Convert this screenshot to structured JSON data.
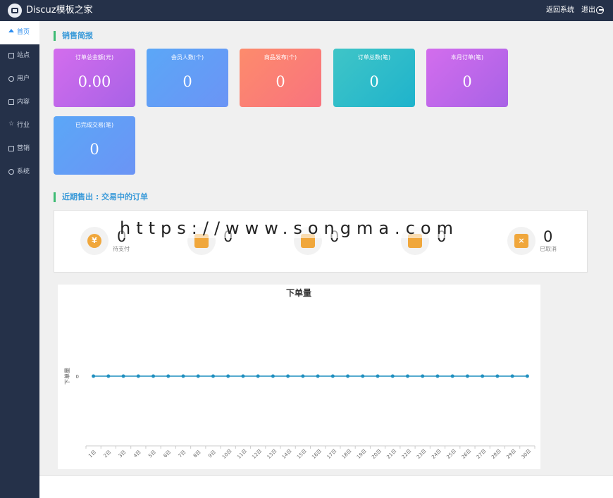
{
  "header": {
    "app_title": "Discuz模板之家",
    "return_link": "返回系统",
    "logout_link": "退出"
  },
  "sidebar": {
    "items": [
      {
        "label": "首页",
        "active": true
      },
      {
        "label": "站点"
      },
      {
        "label": "用户"
      },
      {
        "label": "内容"
      },
      {
        "label": "行业"
      },
      {
        "label": "营销"
      },
      {
        "label": "系统"
      }
    ]
  },
  "sales": {
    "title": "销售简报",
    "cards": [
      {
        "label": "订单总金额(元)",
        "value": "0.00",
        "gradient": [
          "#d36ded",
          "#a862e6"
        ]
      },
      {
        "label": "会员人数(个)",
        "value": "0",
        "gradient": [
          "#5ba7f7",
          "#6b94f5"
        ]
      },
      {
        "label": "商品发布(个)",
        "value": "0",
        "gradient": [
          "#fd8b6c",
          "#f8737e"
        ]
      },
      {
        "label": "订单总数(笔)",
        "value": "0",
        "gradient": [
          "#3fc5c7",
          "#1fb3cc"
        ]
      },
      {
        "label": "本月订单(笔)",
        "value": "0",
        "gradient": [
          "#d36ded",
          "#a862e6"
        ]
      },
      {
        "label": "已完成交易(笔)",
        "value": "0",
        "gradient": [
          "#5ba7f7",
          "#6b94f5"
        ]
      }
    ]
  },
  "orders": {
    "title": "近期售出 : 交易中的订单",
    "items": [
      {
        "count": "0",
        "label": "待支付",
        "icon": "yen-icon"
      },
      {
        "count": "0",
        "label": "",
        "icon": "package-icon"
      },
      {
        "count": "0",
        "label": "",
        "icon": "box-icon"
      },
      {
        "count": "0",
        "label": "",
        "icon": "truck-icon"
      },
      {
        "count": "0",
        "label": "已取消",
        "icon": "cancel-order-icon"
      }
    ]
  },
  "watermark": "https://www.songma.com",
  "chart_data": {
    "type": "line",
    "title": "下单量",
    "ylabel": "下单量",
    "xlabel": "",
    "categories": [
      "1日",
      "2日",
      "3日",
      "4日",
      "5日",
      "6日",
      "7日",
      "8日",
      "9日",
      "10日",
      "11日",
      "12日",
      "13日",
      "14日",
      "15日",
      "16日",
      "17日",
      "18日",
      "19日",
      "20日",
      "21日",
      "22日",
      "23日",
      "24日",
      "25日",
      "26日",
      "27日",
      "28日",
      "29日",
      "30日"
    ],
    "series": [
      {
        "values": [
          0,
          0,
          0,
          0,
          0,
          0,
          0,
          0,
          0,
          0,
          0,
          0,
          0,
          0,
          0,
          0,
          0,
          0,
          0,
          0,
          0,
          0,
          0,
          0,
          0,
          0,
          0,
          0,
          0,
          0
        ]
      }
    ],
    "yticks": [
      "0"
    ],
    "color": "#1f8fbf",
    "grid": false
  }
}
